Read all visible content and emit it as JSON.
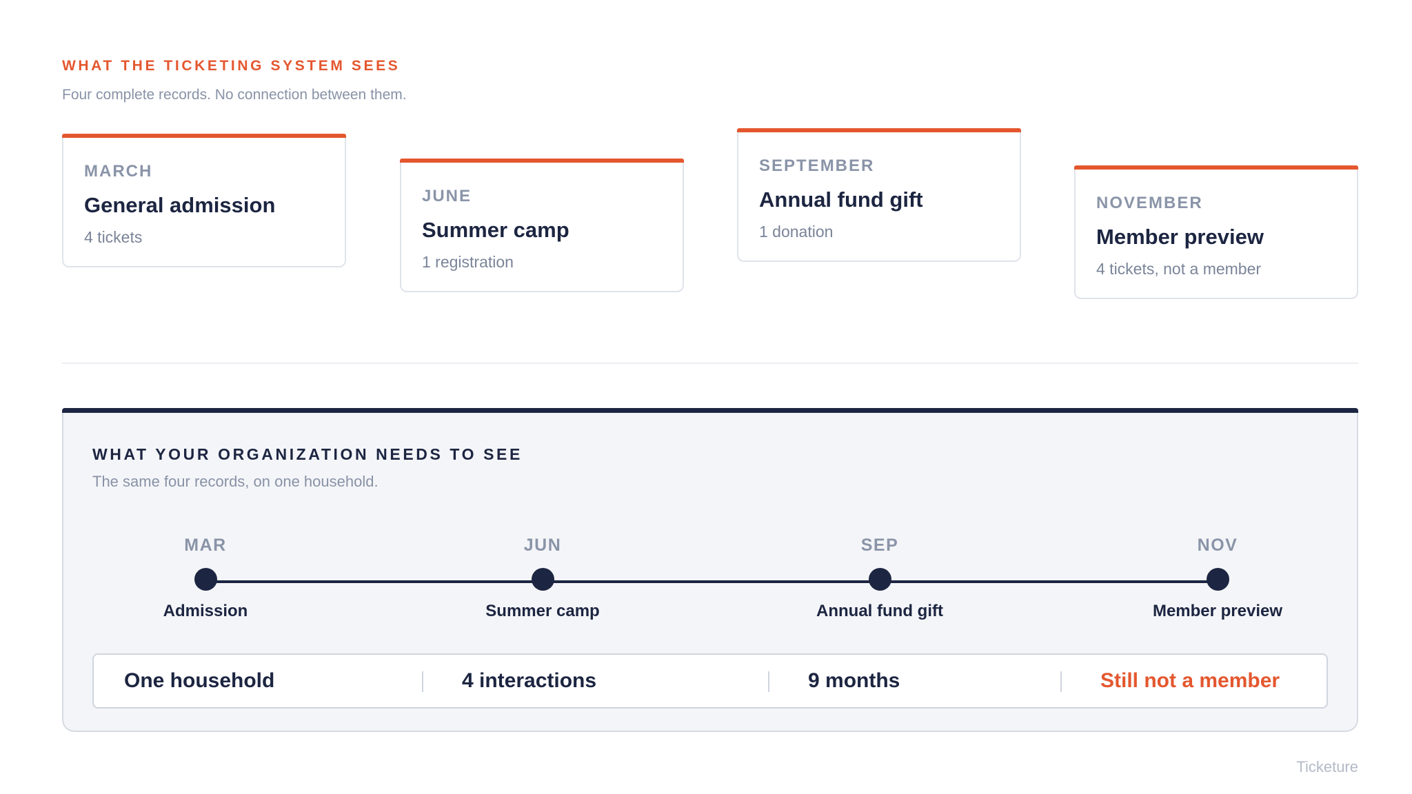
{
  "top_section": {
    "title": "WHAT THE TICKETING SYSTEM SEES",
    "subtitle": "Four complete records. No connection between them.",
    "cards": [
      {
        "month": "MARCH",
        "title": "General admission",
        "detail": "4 tickets"
      },
      {
        "month": "JUNE",
        "title": "Summer camp",
        "detail": "1 registration"
      },
      {
        "month": "SEPTEMBER",
        "title": "Annual fund gift",
        "detail": "1 donation"
      },
      {
        "month": "NOVEMBER",
        "title": "Member preview",
        "detail": "4 tickets, not a member"
      }
    ]
  },
  "bottom_section": {
    "title": "WHAT YOUR ORGANIZATION NEEDS TO SEE",
    "subtitle": "The same four records, on one household.",
    "timeline": [
      {
        "month": "MAR",
        "label": "Admission"
      },
      {
        "month": "JUN",
        "label": "Summer camp"
      },
      {
        "month": "SEP",
        "label": "Annual fund gift"
      },
      {
        "month": "NOV",
        "label": "Member preview"
      }
    ],
    "summary": [
      "One household",
      "4 interactions",
      "9 months",
      "Still not a member"
    ]
  },
  "brand": "Ticketure",
  "colors": {
    "accent": "#e4572e",
    "navy": "#1c2541",
    "muted": "#8a94a8"
  }
}
